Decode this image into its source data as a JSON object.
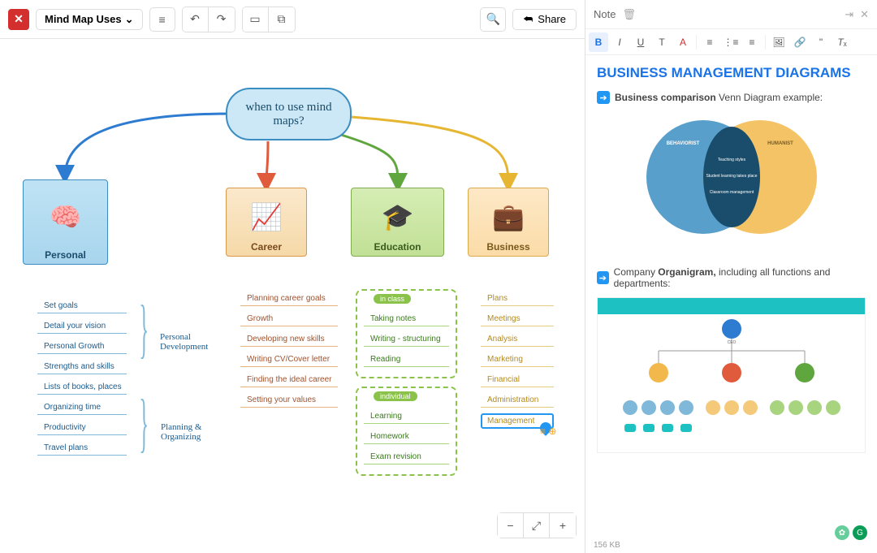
{
  "app": {
    "title": "Mind Map Uses",
    "share_label": "Share"
  },
  "mindmap": {
    "root": "when to use mind maps?",
    "branches": {
      "personal": {
        "label": "Personal",
        "items": [
          "Set goals",
          "Detail your vision",
          "Personal Growth",
          "Strengths and skills",
          "Lists of books, places",
          "Organizing time",
          "Productivity",
          "Travel plans"
        ]
      },
      "career": {
        "label": "Career",
        "items": [
          "Planning career goals",
          "Growth",
          "Developing new skills",
          "Writing CV/Cover letter",
          "Finding the ideal career",
          "Setting  your values"
        ]
      },
      "education": {
        "label": "Education",
        "group1_label": "in class",
        "group1": [
          "Taking notes",
          "Writing - structuring",
          "Reading"
        ],
        "group2_label": "individual",
        "group2": [
          "Learning",
          "Homework",
          "Exam revision"
        ]
      },
      "business": {
        "label": "Business",
        "items": [
          "Plans",
          "Meetings",
          "Analysis",
          "Marketing",
          "Financial",
          "Administration",
          "Management"
        ]
      }
    },
    "annotations": {
      "a1": "Personal Development",
      "a2": "Planning & Organizing"
    },
    "selected": "Management"
  },
  "panel": {
    "title": "Note",
    "heading": "BUSINESS MANAGEMENT DIAGRAMS",
    "line1_bold": "Business comparison",
    "line1_rest": " Venn Diagram example:",
    "venn": {
      "left_label": "BEHAVIORIST",
      "right_label": "HUMANIST",
      "mid1": "Teaching styles",
      "mid2": "Student learning takes place",
      "mid3": "Classroom management"
    },
    "line2_pre": "Company ",
    "line2_bold": "Organigram,",
    "line2_rest": " including all functions and departments:",
    "org_root": "CEO",
    "filesize": "156 KB"
  }
}
